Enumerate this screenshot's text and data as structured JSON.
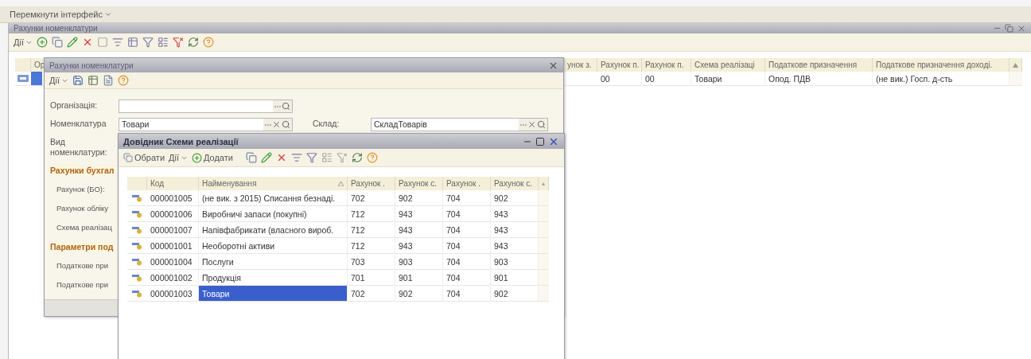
{
  "top_menu": {
    "label": "Перемкнути інтерфейс"
  },
  "main_window": {
    "title": "Рахунки номенклатури",
    "toolbar": {
      "actions_label": "Дії"
    },
    "table": {
      "columns": [
        "Ор",
        "унок з.",
        "Рахунок п.",
        "Рахунок п.",
        "Схема реалізаці",
        "Податкове призначення",
        "Податкове призначення доході."
      ],
      "rows": [
        {
          "selected": true,
          "cells": [
            "",
            "",
            "00",
            "00",
            "Товари",
            "Опод. ПДВ",
            "(не вик.) Госп. д-сть"
          ]
        }
      ]
    }
  },
  "account_dialog": {
    "title": "Рахунки номенклатури",
    "toolbar": {
      "actions_label": "Дії"
    },
    "organization": {
      "label": "Організація:"
    },
    "nomenclature": {
      "label": "Номенклатура",
      "value": "Товари"
    },
    "warehouse": {
      "label": "Склад:",
      "value": "СкладТоварів"
    },
    "nomenclature_type": {
      "label": "Вид номенклатури:"
    },
    "sections": [
      {
        "title": "Рахунки бухгал",
        "labels": [
          "Рахунок (БО):",
          "Рахунок обліку",
          "Схема реалізац"
        ]
      },
      {
        "title": "Параметри под",
        "labels": [
          "Податкове при",
          "Податкове при"
        ]
      }
    ]
  },
  "scheme_dialog": {
    "title": "Довідник Схеми реалізації",
    "toolbar": {
      "select_label": "Обрати",
      "actions_label": "Дії",
      "add_label": "Додати"
    },
    "table": {
      "columns": [
        "Код",
        "Найменування",
        "Рахунок .",
        "Рахунок с.",
        "Рахунок .",
        "Рахунок с."
      ],
      "rows": [
        {
          "code": "000001005",
          "name": "(не вик. з 2015) Списання безнаді.",
          "accounts": [
            "702",
            "902",
            "704",
            "902"
          ],
          "selected": false
        },
        {
          "code": "000001006",
          "name": "Виробничі запаси (покупні)",
          "accounts": [
            "712",
            "943",
            "704",
            "943"
          ],
          "selected": false
        },
        {
          "code": "000001007",
          "name": "Напівфабрикати (власного вироб.",
          "accounts": [
            "712",
            "943",
            "704",
            "943"
          ],
          "selected": false
        },
        {
          "code": "000001001",
          "name": "Необоротні активи",
          "accounts": [
            "712",
            "943",
            "704",
            "943"
          ],
          "selected": false
        },
        {
          "code": "000001004",
          "name": "Послуги",
          "accounts": [
            "703",
            "903",
            "704",
            "903"
          ],
          "selected": false
        },
        {
          "code": "000001002",
          "name": "Продукція",
          "accounts": [
            "701",
            "901",
            "704",
            "901"
          ],
          "selected": false
        },
        {
          "code": "000001003",
          "name": "Товари",
          "accounts": [
            "702",
            "902",
            "704",
            "902"
          ],
          "selected": true
        }
      ]
    }
  }
}
